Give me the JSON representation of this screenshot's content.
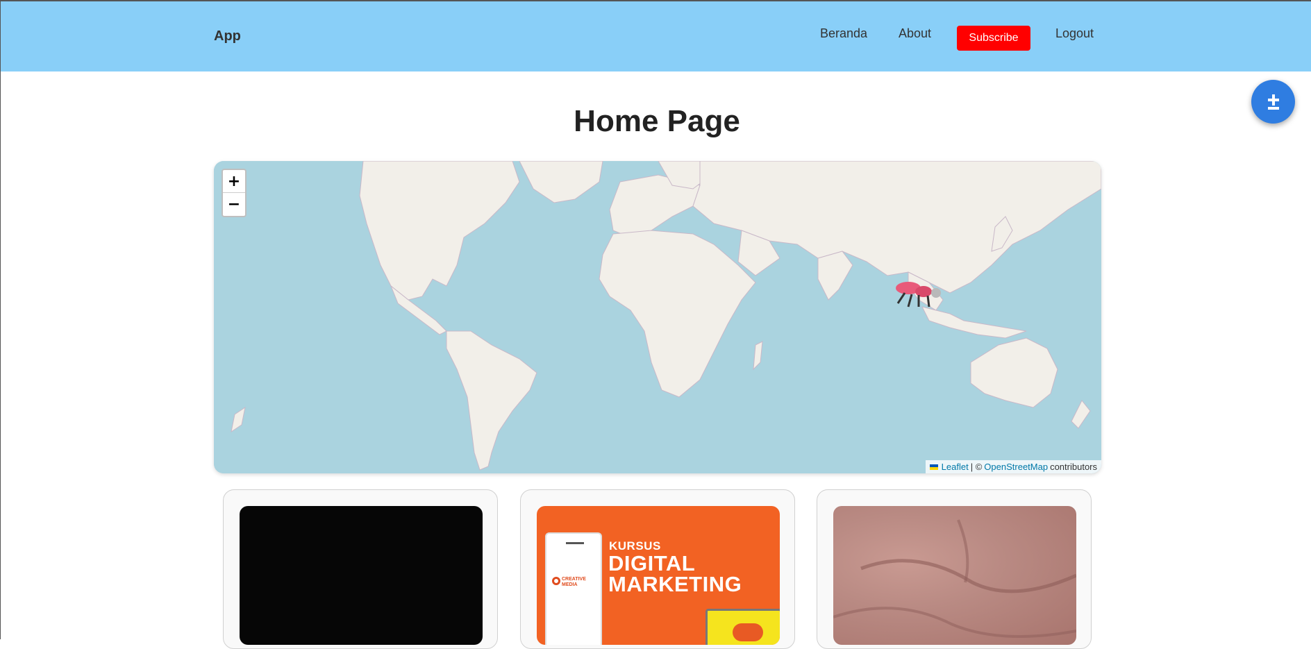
{
  "navbar": {
    "brand": "App",
    "links": [
      "Beranda",
      "About",
      "Logout"
    ],
    "subscribe_label": "Subscribe",
    "background": "#89cff8",
    "subscribe_color": "#ff0000"
  },
  "fab": {
    "icon": "plus-minus-icon",
    "color": "#2f7de1"
  },
  "page": {
    "title": "Home Page"
  },
  "map": {
    "zoom_in": "+",
    "zoom_out": "−",
    "attribution": {
      "leaflet": "Leaflet",
      "separator": "| ©",
      "osm": "OpenStreetMap",
      "suffix": "contributors"
    },
    "marker_icon": "ant-marker-icon"
  },
  "cards": [
    {
      "image": "black-image"
    },
    {
      "image": "digital-marketing-banner",
      "kursus": "KURSUS",
      "title_line1": "DIGITAL",
      "title_line2": "MARKETING",
      "logo_line1": "CREATIVE",
      "logo_line2": "MEDIA",
      "cloud_text": "Digital Marketing"
    },
    {
      "image": "skin-closeup-image"
    }
  ]
}
